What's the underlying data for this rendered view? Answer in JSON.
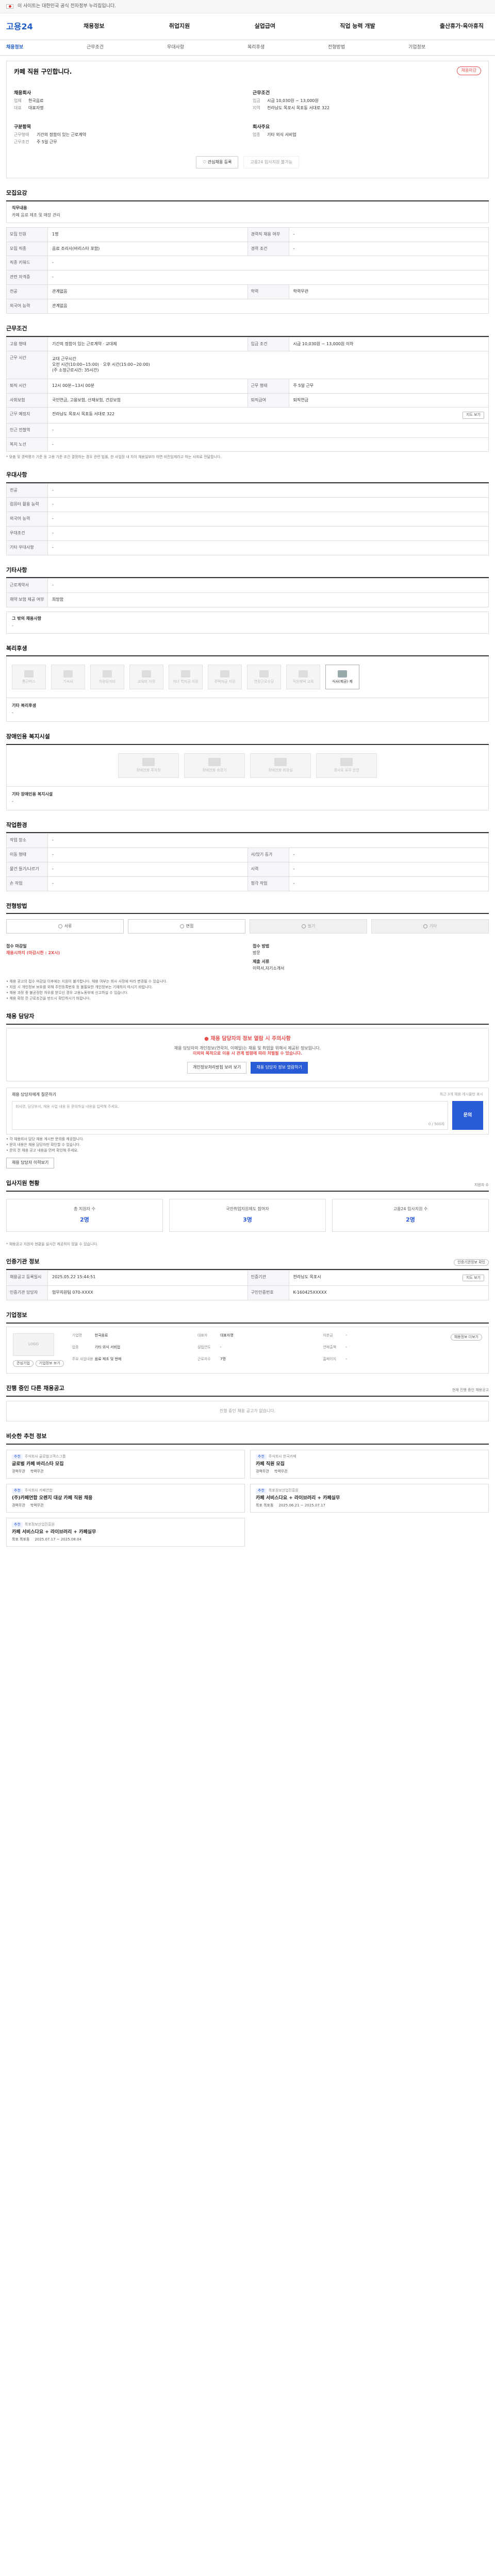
{
  "topbar": {
    "text": "이 사이트는 대한민국 공식 전자정부 누리집입니다."
  },
  "header": {
    "logo": "고용24",
    "gnb": [
      "채용정보",
      "취업지원",
      "실업급여",
      "직업 능력 개발",
      "출산휴가·육아휴직"
    ]
  },
  "subnav": [
    "채용정보",
    "근무조건",
    "우대사항",
    "복리후생",
    "전형방법",
    "기업정보"
  ],
  "overview": {
    "title": "카페 직원 구인합니다.",
    "badge": "채용마감",
    "left": {
      "head1": "채용회사",
      "rows1": [
        {
          "k": "업체",
          "v": "한국음료"
        },
        {
          "k": "대표",
          "v": "대표자명"
        }
      ],
      "head2": "구분항목",
      "rows2": [
        {
          "k": "근무형태",
          "v": "기간의 정함이 있는 근로계약"
        },
        {
          "k": "근무조건",
          "v": "주 5일 근무"
        }
      ]
    },
    "right": {
      "head1": "근무조건",
      "rows1": [
        {
          "k": "임금",
          "v": "시급 10,030원 ~ 13,000원"
        },
        {
          "k": "지역",
          "v": "전라남도 목포시 목포동 서대로 322"
        }
      ],
      "head2": "회사주요",
      "rows2": [
        {
          "k": "업종",
          "v": "기타 외식 서비업"
        }
      ]
    },
    "btn_fav": "관심채용 등록",
    "btn_apply": "고용24 입사지원 불가능"
  },
  "recruit": {
    "title": "모집요강",
    "note_title": "직무내용",
    "note_body": "카페 음료 제조 및 매장 관리",
    "rows": [
      [
        {
          "k": "모집 인원",
          "v": "1명"
        },
        {
          "k": "경력직 채용 여부",
          "v": "-"
        }
      ],
      [
        {
          "k": "모집 직종",
          "v": "음료 조리사(바리스타 포함)"
        },
        {
          "k": "경력 조건",
          "v": "-"
        }
      ],
      [
        {
          "k": "직종 키워드",
          "v": "-"
        }
      ],
      [
        {
          "k": "관련 자격증",
          "v": "-"
        }
      ],
      [
        {
          "k": "전공",
          "v": "관계없음"
        },
        {
          "k": "학력",
          "v": "학력무관"
        }
      ],
      [
        {
          "k": "외국어 능력",
          "v": "관계없음"
        }
      ]
    ]
  },
  "conditions": {
    "title": "근무조건",
    "rows": [
      [
        {
          "k": "고용 형태",
          "v": "기간의 정함이 있는 근로계약 · 교대제"
        },
        {
          "k": "임금 조건",
          "v": "시급 10,030원 ~ 13,000원 이하"
        }
      ],
      [
        {
          "k": "근무 시간",
          "v": "교대 근무시간\n오전 시간(10:00~15:00) · 오후 시간(15:00~20:00)\n(주 소정근로시간: 35시간)"
        }
      ],
      [
        {
          "k": "퇴직 시간",
          "v": "12시 00분~13시 00분"
        },
        {
          "k": "근무 형태",
          "v": "주 5일 근무"
        }
      ],
      [
        {
          "k": "사회보험",
          "v": "국민연금, 고용보험, 산재보험, 건강보험"
        },
        {
          "k": "퇴직급여",
          "v": "퇴직연금"
        }
      ],
      [
        {
          "k": "근무 예정지",
          "v": "전라남도 목포시 목포동 서대로 322"
        }
      ],
      [
        {
          "k": "인근 전철역",
          "v": "-"
        }
      ],
      [
        {
          "k": "복지 노선",
          "v": "-"
        }
      ]
    ],
    "map_btn": "지도 보기",
    "footnote": "* 맞춤 및 경력평가 기준 등 고용 기준 조건 결정하는 경우 관련 법률, 한 사업장 내 차이 채용일부라 하면 비전임제라고 하는 사회로 전달합니다."
  },
  "preferences": {
    "title": "우대사항",
    "rows": [
      [
        {
          "k": "전공",
          "v": "-"
        }
      ],
      [
        {
          "k": "컴퓨터 활용 능력",
          "v": "-"
        }
      ],
      [
        {
          "k": "외국어 능력",
          "v": "-"
        }
      ],
      [
        {
          "k": "우대조건",
          "v": "-"
        }
      ],
      [
        {
          "k": "기타 우대사항",
          "v": "-"
        }
      ]
    ]
  },
  "etc": {
    "title": "기타사항",
    "rows": [
      [
        {
          "k": "근로계약서",
          "v": "-"
        }
      ],
      [
        {
          "k": "채약 보험 제공 여부",
          "v": "희망함"
        }
      ]
    ],
    "note_title": "그 밖의 채용사항",
    "note_body": "-"
  },
  "welfare": {
    "title": "복리후생",
    "items": [
      "통근버스",
      "기숙사",
      "차량유지비",
      "교육비 지원",
      "자녀 학자금 지원",
      "주택자금 지원",
      "연장근로수당",
      "직원혜택 교육",
      "식사(제공) 제"
    ],
    "active_index": 8,
    "other_title": "기타 복리후생",
    "other_body": "-"
  },
  "disability": {
    "title": "장애인용 복지시설",
    "items": [
      "장애인용 주차장",
      "장애인용 승강기",
      "장애인용 화장실",
      "경사로 유무 안전"
    ],
    "other_title": "기타 장애인용 복지시설",
    "other_body": "-"
  },
  "work_env": {
    "title": "작업환경",
    "rows": [
      [
        {
          "k": "작업 장소",
          "v": "-"
        }
      ],
      [
        {
          "k": "이동 형태",
          "v": "-"
        },
        {
          "k": "서/앉기 등가",
          "v": "-"
        }
      ],
      [
        {
          "k": "물건 들기/나르기",
          "v": "-"
        },
        {
          "k": "시력",
          "v": "-"
        }
      ],
      [
        {
          "k": "손 작업",
          "v": "-"
        },
        {
          "k": "청각 작업",
          "v": "-"
        }
      ]
    ]
  },
  "selection": {
    "title": "전형방법",
    "buttons": [
      {
        "label": "서류",
        "disabled": false
      },
      {
        "label": "면접",
        "disabled": false
      },
      {
        "label": "필기",
        "disabled": true
      },
      {
        "label": "기타",
        "disabled": true
      }
    ],
    "left_k1": "접수 마감일",
    "left_v1": "채용시까지 (마감시한 : 2X시)",
    "right_k1": "접수 방법",
    "right_v1": "방문",
    "right_k2": "제출 서류",
    "right_v2": "이력서,자기소개서",
    "bullets": [
      "채용 공고의 접수 마감일 이후에는 지원이 불가합니다. 채용 여부는 회사 사정에 따라 변경될 수 있습니다.",
      "지원 시 개인정보 보호를 위해 주민등록번호 등 불필요한 개인정보는 기재하지 마시기 바랍니다.",
      "채용 과정 중 불공정한 처우를 받으신 경우 고용노동부에 신고하실 수 있습니다.",
      "채용 확정 전 근로조건을 반드시 확인하시기 바랍니다."
    ]
  },
  "manager": {
    "title": "채용 담당자",
    "warn_title": "채용 담당자의 정보 열람 시 주의사항",
    "warn_body1": "채용 담당자의 개인정보(연락처, 이메일)는 채용 및 취업을 위해서 제공된 정보입니다.",
    "warn_body2": "이외의 목적으로 이용 시 관계 법령에 따라 처벌될 수 있습니다.",
    "btn_privacy": "개인정보처리방침 보러 보기",
    "btn_view": "채용 담당자 정보 열람하기",
    "msg_label": "채용 담당자에게 질문하기",
    "msg_hint": "최근 3개 채용 게시물만 표시",
    "msg_placeholder": "회사명, 담당부서, 채용 사업 내용 등 문의하실 내용을 입력해 주세요.",
    "msg_count": "0 / 500자",
    "send": "문의",
    "bullets": [
      "각 채용회사 담당 채용 게시판 문의를 제공합니다.",
      "문의 내용은 채용 담당자만 확인할 수 있습니다.",
      "문의 전 채용 공고 내용을 먼저 확인해 주세요."
    ],
    "history_btn": "채용 담당자 이력보기"
  },
  "apply_status": {
    "title": "입사지원 현황",
    "right": "지원자 수",
    "stats": [
      {
        "label": "총 지원자 수",
        "value": "2명"
      },
      {
        "label": "국민취업지원제도 참여자",
        "value": "3명"
      },
      {
        "label": "고용24 입사지원 수",
        "value": "2명"
      }
    ],
    "note": "* 채용공고 지원자 현황을 실시간 제공하지 않을 수 있습니다."
  },
  "reg_info": {
    "title": "인증기관 정보",
    "pill": "인증기관정보 확인",
    "rows": [
      [
        {
          "k": "채용공고 등록일시",
          "v": "2025.05.22 15:44:51"
        },
        {
          "k": "인증기관",
          "v": "전라남도 목포시"
        }
      ],
      [
        {
          "k": "인증기관 담당자",
          "v": "업무지원팀 070-XXXX"
        },
        {
          "k": "구인인증번호",
          "v": "K-160425XXXXX"
        }
      ]
    ],
    "map_btn": "지도 보기"
  },
  "company": {
    "title": "기업정보",
    "logo": "LOGO",
    "cols": [
      [
        {
          "k": "기업명",
          "v": "한국음료"
        },
        {
          "k": "업종",
          "v": "기타 외식 서비업"
        },
        {
          "k": "주요 사업내용",
          "v": "음료 제조 및 판매"
        }
      ],
      [
        {
          "k": "대표자",
          "v": "대표자명"
        },
        {
          "k": "설립연도",
          "v": "-"
        },
        {
          "k": "근로자수",
          "v": "7명"
        }
      ],
      [
        {
          "k": "자본금",
          "v": "-"
        },
        {
          "k": "연매출액",
          "v": "-"
        },
        {
          "k": "홈페이지",
          "v": "-"
        }
      ]
    ],
    "btn1": "관심기업",
    "btn2": "기업정보 보기",
    "btn3": "채용정보 더보기"
  },
  "other_jobs": {
    "title": "진행 중인 다른 채용공고",
    "right": "현재 진행 중인 채용공고",
    "empty": "진행 중인 채용 공고가 없습니다."
  },
  "recs": {
    "title": "비슷한 추천 정보",
    "items": [
      {
        "badge": "추천",
        "co": "주식회사 골로벌고객스그룹",
        "title": "글로벌 카페 바리스타 모집",
        "m1": "경력무관",
        "m2": "학력무관"
      },
      {
        "badge": "추천",
        "co": "주식회사 한국카페",
        "title": "카페 직원 모집",
        "m1": "경력무관",
        "m2": "학력무관"
      },
      {
        "badge": "추천",
        "co": "주식회사 카페연합",
        "title": "(주)카페연합 오렌지 대상 카페 직원 채용",
        "m1": "경력무관",
        "m2": "학력무관"
      },
      {
        "badge": "추천",
        "co": "목포정보산업진흥원",
        "title": "카페 서비스다요 + 라이브러리 + 카페실무",
        "m1": "목포 목포동",
        "m2": "2025.06.21 ~ 2025.07.17"
      },
      {
        "badge": "추천",
        "co": "목포정보산업진흥원",
        "title": "카페 서비스다요 + 라이브러리 + 카페실무",
        "m1": "목포 목포동",
        "m2": "2025.07.17 ~ 2025.08.04"
      }
    ]
  }
}
